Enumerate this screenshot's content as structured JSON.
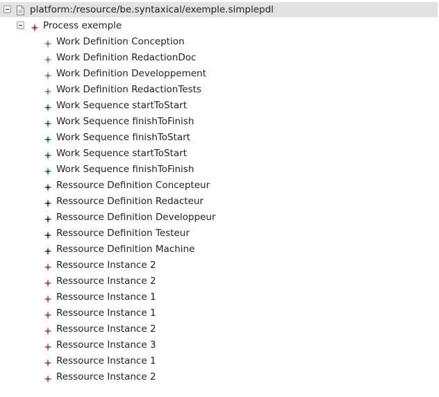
{
  "tree": {
    "root": {
      "label": "platform:/resource/be.syntaxical/exemple.simplepdl",
      "icon": "file-icon",
      "expanded": true
    },
    "process": {
      "label": "Process exemple",
      "icon": "process-icon",
      "icon_color": "#b03a4a",
      "expanded": true
    },
    "children": [
      {
        "label": "Work Definition Conception",
        "kind": "work-definition",
        "icon_color": "#6d8fb5"
      },
      {
        "label": "Work Definition RedactionDoc",
        "kind": "work-definition",
        "icon_color": "#6d8fb5"
      },
      {
        "label": "Work Definition Developpement",
        "kind": "work-definition",
        "icon_color": "#6d8fb5"
      },
      {
        "label": "Work Definition RedactionTests",
        "kind": "work-definition",
        "icon_color": "#6d8fb5"
      },
      {
        "label": "Work Sequence startToStart",
        "kind": "work-sequence",
        "icon_color": "#2f7a52"
      },
      {
        "label": "Work Sequence finishToFinish",
        "kind": "work-sequence",
        "icon_color": "#2f7a52"
      },
      {
        "label": "Work Sequence finishToStart",
        "kind": "work-sequence",
        "icon_color": "#2f7a52"
      },
      {
        "label": "Work Sequence startToStart",
        "kind": "work-sequence",
        "icon_color": "#2f7a52"
      },
      {
        "label": "Work Sequence finishToFinish",
        "kind": "work-sequence",
        "icon_color": "#2f7a52"
      },
      {
        "label": "Ressource Definition Concepteur",
        "kind": "ressource-definition",
        "icon_color": "#4a3f78"
      },
      {
        "label": "Ressource Definition Redacteur",
        "kind": "ressource-definition",
        "icon_color": "#4a3f78"
      },
      {
        "label": "Ressource Definition Developpeur",
        "kind": "ressource-definition",
        "icon_color": "#4a3f78"
      },
      {
        "label": "Ressource Definition Testeur",
        "kind": "ressource-definition",
        "icon_color": "#4a3f78"
      },
      {
        "label": "Ressource Definition Machine",
        "kind": "ressource-definition",
        "icon_color": "#4a3f78"
      },
      {
        "label": "Ressource Instance 2",
        "kind": "ressource-instance",
        "icon_color": "#b0506a"
      },
      {
        "label": "Ressource Instance 2",
        "kind": "ressource-instance",
        "icon_color": "#b0506a"
      },
      {
        "label": "Ressource Instance 1",
        "kind": "ressource-instance",
        "icon_color": "#b0506a"
      },
      {
        "label": "Ressource Instance 1",
        "kind": "ressource-instance",
        "icon_color": "#b0506a"
      },
      {
        "label": "Ressource Instance 2",
        "kind": "ressource-instance",
        "icon_color": "#b0506a"
      },
      {
        "label": "Ressource Instance 3",
        "kind": "ressource-instance",
        "icon_color": "#b0506a"
      },
      {
        "label": "Ressource Instance 1",
        "kind": "ressource-instance",
        "icon_color": "#b0506a"
      },
      {
        "label": "Ressource Instance 2",
        "kind": "ressource-instance",
        "icon_color": "#b0506a"
      }
    ]
  }
}
